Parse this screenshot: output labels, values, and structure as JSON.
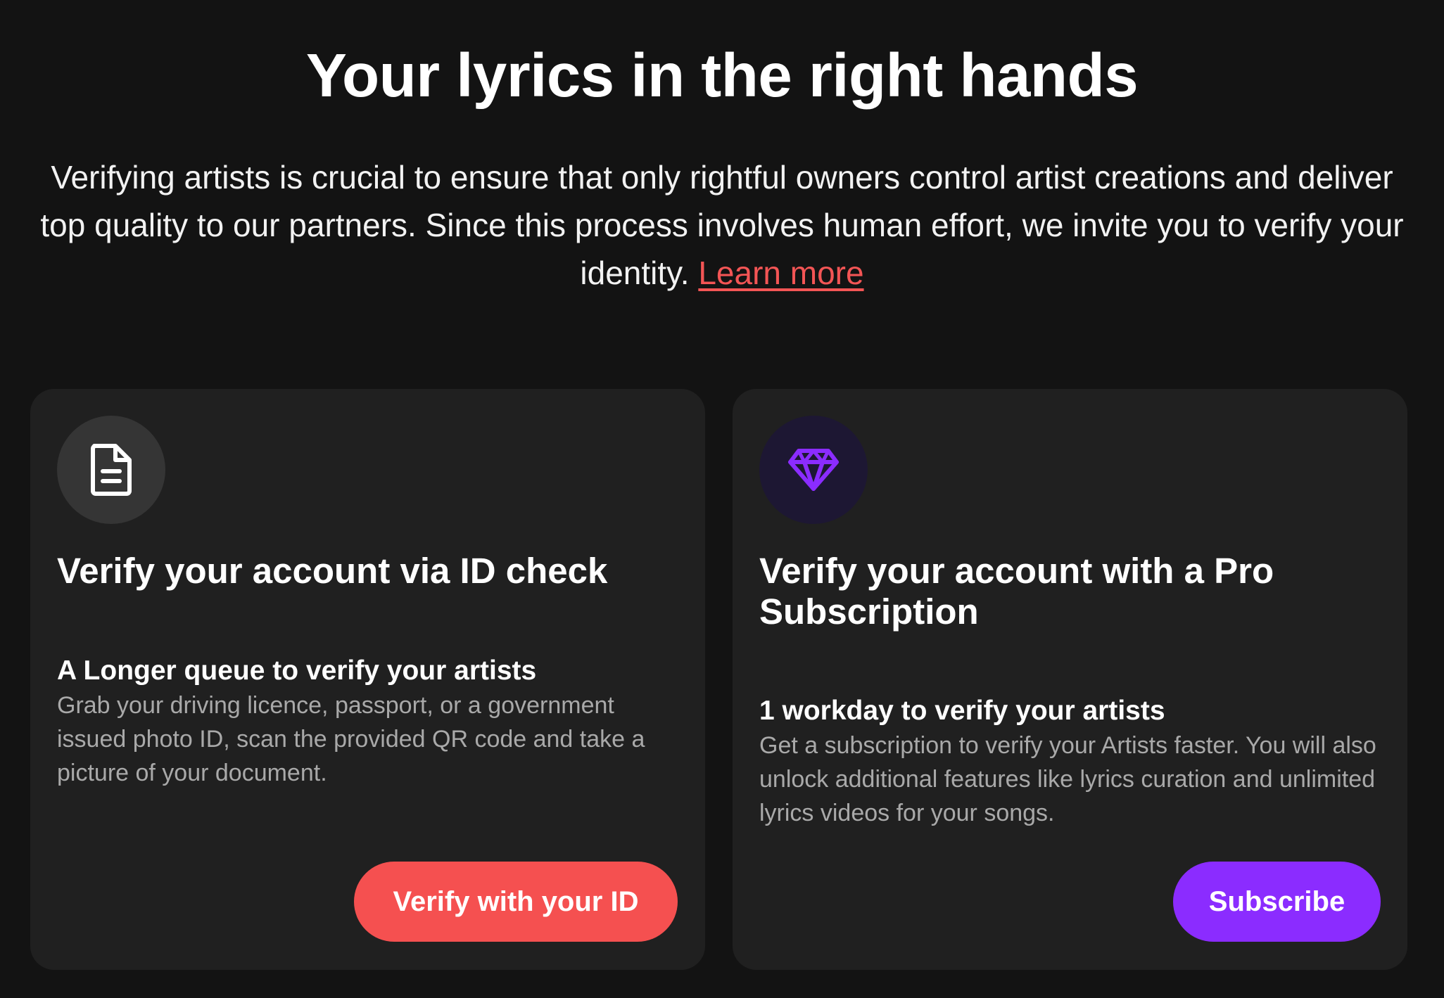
{
  "hero": {
    "title": "Your lyrics in the right hands",
    "description": "Verifying artists is crucial to ensure that only rightful owners control artist creations and deliver top quality to our partners. Since this process involves human effort, we invite you to verify your identity.",
    "learn_more": "Learn more"
  },
  "cards": [
    {
      "icon": "document-icon",
      "title": "Verify your account via ID check",
      "subtitle": "A Longer queue to verify your artists",
      "text": "Grab your driving licence, passport, or a government issued photo ID, scan the provided QR code and take a picture of your document.",
      "button": "Verify with your ID",
      "button_color": "#f55050"
    },
    {
      "icon": "diamond-icon",
      "title": "Verify your account with a Pro Subscription",
      "subtitle": "1 workday to verify your artists",
      "text": "Get a subscription to verify your Artists faster. You will also unlock additional features like lyrics curation and unlimited lyrics videos for your songs.",
      "button": "Subscribe",
      "button_color": "#8b2cff"
    }
  ],
  "colors": {
    "background": "#131313",
    "card_background": "#202020",
    "link": "#f35555",
    "accent_red": "#f55050",
    "accent_purple": "#8b2cff",
    "muted_text": "#a9a9a9"
  }
}
